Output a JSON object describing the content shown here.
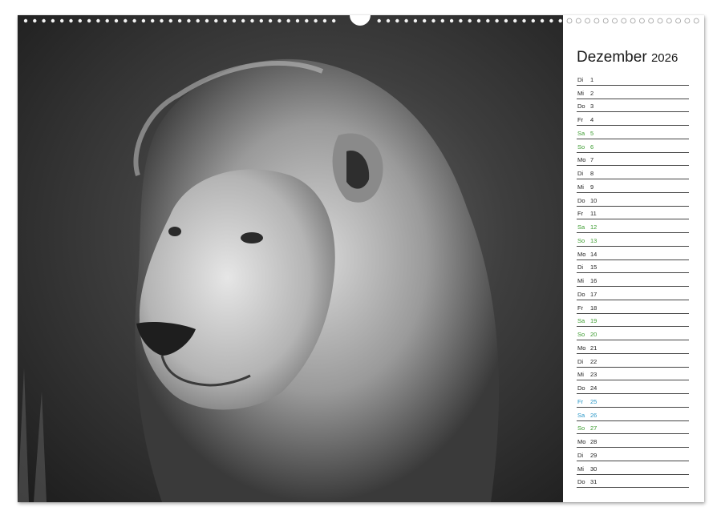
{
  "calendar": {
    "month": "Dezember",
    "year": "2026",
    "days": [
      {
        "dow": "Di",
        "date": "1",
        "type": "weekday"
      },
      {
        "dow": "Mi",
        "date": "2",
        "type": "weekday"
      },
      {
        "dow": "Do",
        "date": "3",
        "type": "weekday"
      },
      {
        "dow": "Fr",
        "date": "4",
        "type": "weekday"
      },
      {
        "dow": "Sa",
        "date": "5",
        "type": "weekend"
      },
      {
        "dow": "So",
        "date": "6",
        "type": "weekend"
      },
      {
        "dow": "Mo",
        "date": "7",
        "type": "weekday"
      },
      {
        "dow": "Di",
        "date": "8",
        "type": "weekday"
      },
      {
        "dow": "Mi",
        "date": "9",
        "type": "weekday"
      },
      {
        "dow": "Do",
        "date": "10",
        "type": "weekday"
      },
      {
        "dow": "Fr",
        "date": "11",
        "type": "weekday"
      },
      {
        "dow": "Sa",
        "date": "12",
        "type": "weekend"
      },
      {
        "dow": "So",
        "date": "13",
        "type": "weekend"
      },
      {
        "dow": "Mo",
        "date": "14",
        "type": "weekday"
      },
      {
        "dow": "Di",
        "date": "15",
        "type": "weekday"
      },
      {
        "dow": "Mi",
        "date": "16",
        "type": "weekday"
      },
      {
        "dow": "Do",
        "date": "17",
        "type": "weekday"
      },
      {
        "dow": "Fr",
        "date": "18",
        "type": "weekday"
      },
      {
        "dow": "Sa",
        "date": "19",
        "type": "weekend"
      },
      {
        "dow": "So",
        "date": "20",
        "type": "weekend"
      },
      {
        "dow": "Mo",
        "date": "21",
        "type": "weekday"
      },
      {
        "dow": "Di",
        "date": "22",
        "type": "weekday"
      },
      {
        "dow": "Mi",
        "date": "23",
        "type": "weekday"
      },
      {
        "dow": "Do",
        "date": "24",
        "type": "weekday"
      },
      {
        "dow": "Fr",
        "date": "25",
        "type": "holiday"
      },
      {
        "dow": "Sa",
        "date": "26",
        "type": "holiday"
      },
      {
        "dow": "So",
        "date": "27",
        "type": "weekend"
      },
      {
        "dow": "Mo",
        "date": "28",
        "type": "weekday"
      },
      {
        "dow": "Di",
        "date": "29",
        "type": "weekday"
      },
      {
        "dow": "Mi",
        "date": "30",
        "type": "weekday"
      },
      {
        "dow": "Do",
        "date": "31",
        "type": "weekday"
      }
    ]
  },
  "colors": {
    "weekend": "#3b9b2f",
    "holiday": "#2a97c7",
    "text": "#222222"
  },
  "photo": {
    "subject": "lion-portrait"
  }
}
